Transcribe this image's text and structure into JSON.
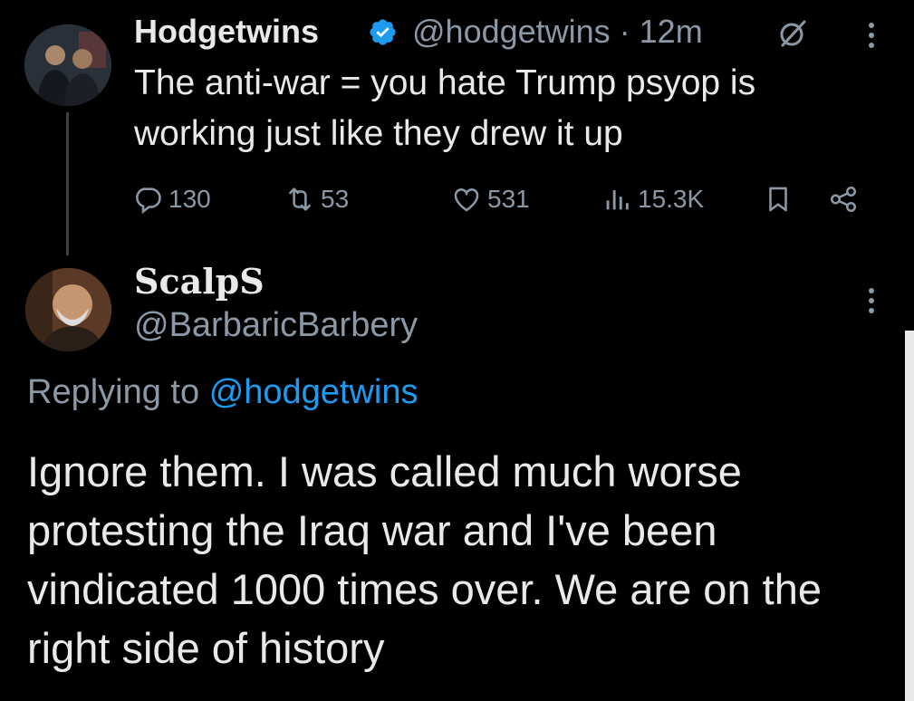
{
  "tweet": {
    "author_name": "Hodgetwins",
    "author_handle": "@hodgetwins",
    "meta": "@hodgetwins · 12m",
    "text": "The anti-war = you hate Trump psyop is working just like they drew it up",
    "stats": {
      "replies": "130",
      "retweets": "53",
      "likes": "531",
      "views": "15.3K"
    }
  },
  "reply": {
    "author_name": "ScalpS",
    "author_handle": "@BarbaricBarbery",
    "replying_prefix": "Replying to",
    "replying_to": "@hodgetwins",
    "text": "Ignore them. I was called much worse protesting the Iraq war and I've been vindicated 1000 times over. We are on the right side of history"
  },
  "colors": {
    "background": "#000000",
    "text": "#e7e9ea",
    "secondary": "#8b98a5",
    "accent": "#1d9bf0"
  },
  "icons": {
    "verified": "verified-badge-icon",
    "grok": "grok-icon",
    "more": "more-dots-icon",
    "reply": "reply-icon",
    "retweet": "retweet-icon",
    "like": "heart-icon",
    "views": "views-icon",
    "bookmark": "bookmark-icon",
    "share": "share-icon"
  }
}
